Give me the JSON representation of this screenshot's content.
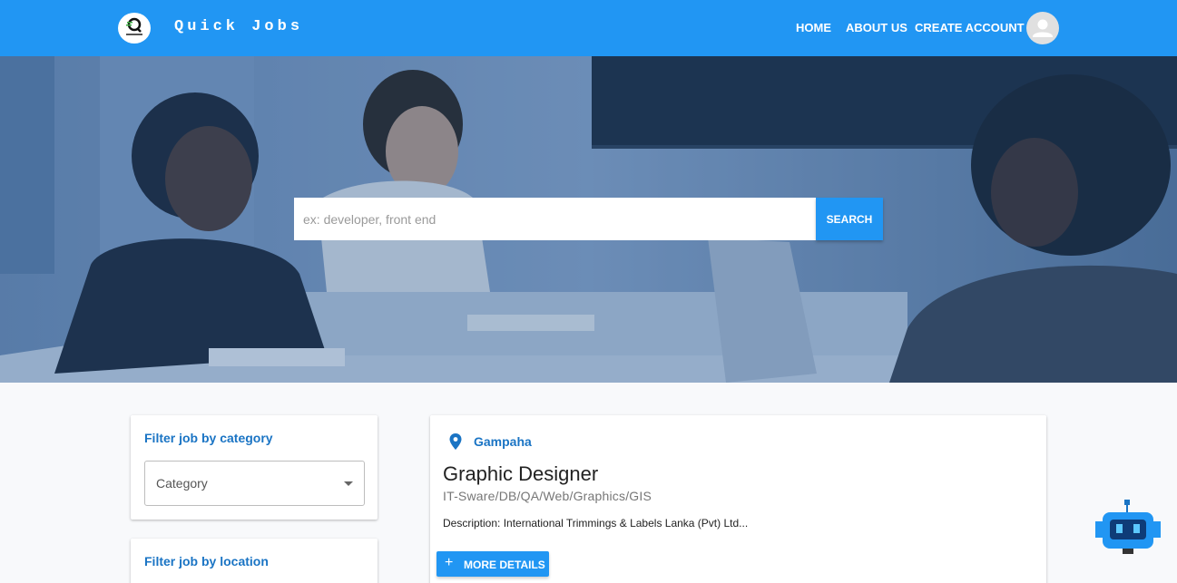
{
  "navbar": {
    "brand": "Quick Jobs",
    "logo_icon": "quick-jobs-logo",
    "links": [
      "HOME",
      "ABOUT US",
      "CREATE ACCOUNT"
    ],
    "avatar_icon": "account-avatar-icon",
    "color": "#2196f3"
  },
  "hero": {
    "search": {
      "placeholder": "ex: developer, front end",
      "button_label": "SEARCH"
    }
  },
  "filters": {
    "category": {
      "title": "Filter job by category",
      "select_label": "Category"
    },
    "location": {
      "title": "Filter job by location"
    }
  },
  "job": {
    "location": "Gampaha",
    "title": "Graphic Designer",
    "category": "IT-Sware/DB/QA/Web/Graphics/GIS",
    "description": "Description: International Trimmings & Labels Lanka (Pvt) Ltd...",
    "button_label": "MORE DETAILS"
  },
  "chatbot": {
    "icon": "robot-chatbot-icon"
  },
  "colors": {
    "primary": "#2196f3",
    "accent_text": "#1a74c4"
  }
}
